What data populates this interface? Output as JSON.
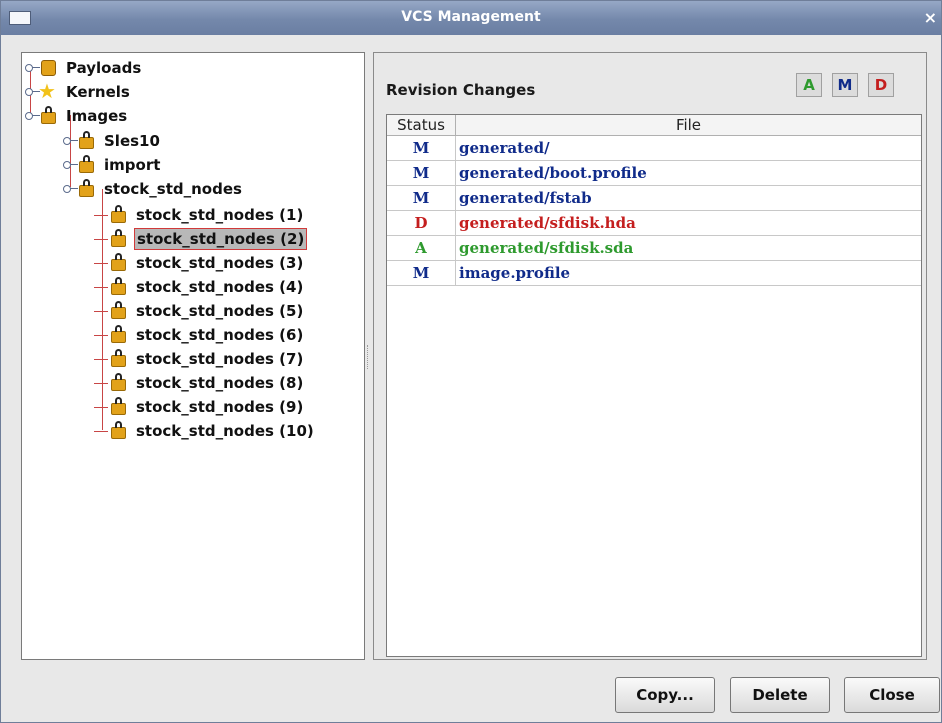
{
  "window": {
    "title": "VCS Management",
    "close_glyph": "×"
  },
  "tree": {
    "items": [
      {
        "label": "Payloads",
        "icon": "bag-icon"
      },
      {
        "label": "Kernels",
        "icon": "star-icon"
      },
      {
        "label": "Images",
        "icon": "lock-icon"
      },
      {
        "label": "Sles10",
        "icon": "lock-icon"
      },
      {
        "label": "import",
        "icon": "lock-icon"
      },
      {
        "label": "stock_std_nodes",
        "icon": "lock-icon"
      },
      {
        "label": "stock_std_nodes (1)",
        "icon": "lock-icon"
      },
      {
        "label": "stock_std_nodes (2)",
        "icon": "lock-icon",
        "selected": true
      },
      {
        "label": "stock_std_nodes (3)",
        "icon": "lock-icon"
      },
      {
        "label": "stock_std_nodes (4)",
        "icon": "lock-icon"
      },
      {
        "label": "stock_std_nodes (5)",
        "icon": "lock-icon"
      },
      {
        "label": "stock_std_nodes (6)",
        "icon": "lock-icon"
      },
      {
        "label": "stock_std_nodes (7)",
        "icon": "lock-icon"
      },
      {
        "label": "stock_std_nodes (8)",
        "icon": "lock-icon"
      },
      {
        "label": "stock_std_nodes (9)",
        "icon": "lock-icon"
      },
      {
        "label": "stock_std_nodes (10)",
        "icon": "lock-icon"
      }
    ]
  },
  "revision": {
    "title": "Revision Changes",
    "filters": [
      {
        "label": "A",
        "color": "#2e9a2e"
      },
      {
        "label": "M",
        "color": "#102b8a"
      },
      {
        "label": "D",
        "color": "#c41e1e"
      }
    ],
    "columns": {
      "status": "Status",
      "file": "File"
    },
    "rows": [
      {
        "status": "M",
        "file": "generated/",
        "color": "#102b8a"
      },
      {
        "status": "M",
        "file": "generated/boot.profile",
        "color": "#102b8a"
      },
      {
        "status": "M",
        "file": "generated/fstab",
        "color": "#102b8a"
      },
      {
        "status": "D",
        "file": "generated/sfdisk.hda",
        "color": "#c41e1e"
      },
      {
        "status": "A",
        "file": "generated/sfdisk.sda",
        "color": "#2e9a2e"
      },
      {
        "status": "M",
        "file": "image.profile",
        "color": "#102b8a"
      }
    ]
  },
  "buttons": {
    "copy": "Copy...",
    "delete": "Delete",
    "close": "Close"
  }
}
